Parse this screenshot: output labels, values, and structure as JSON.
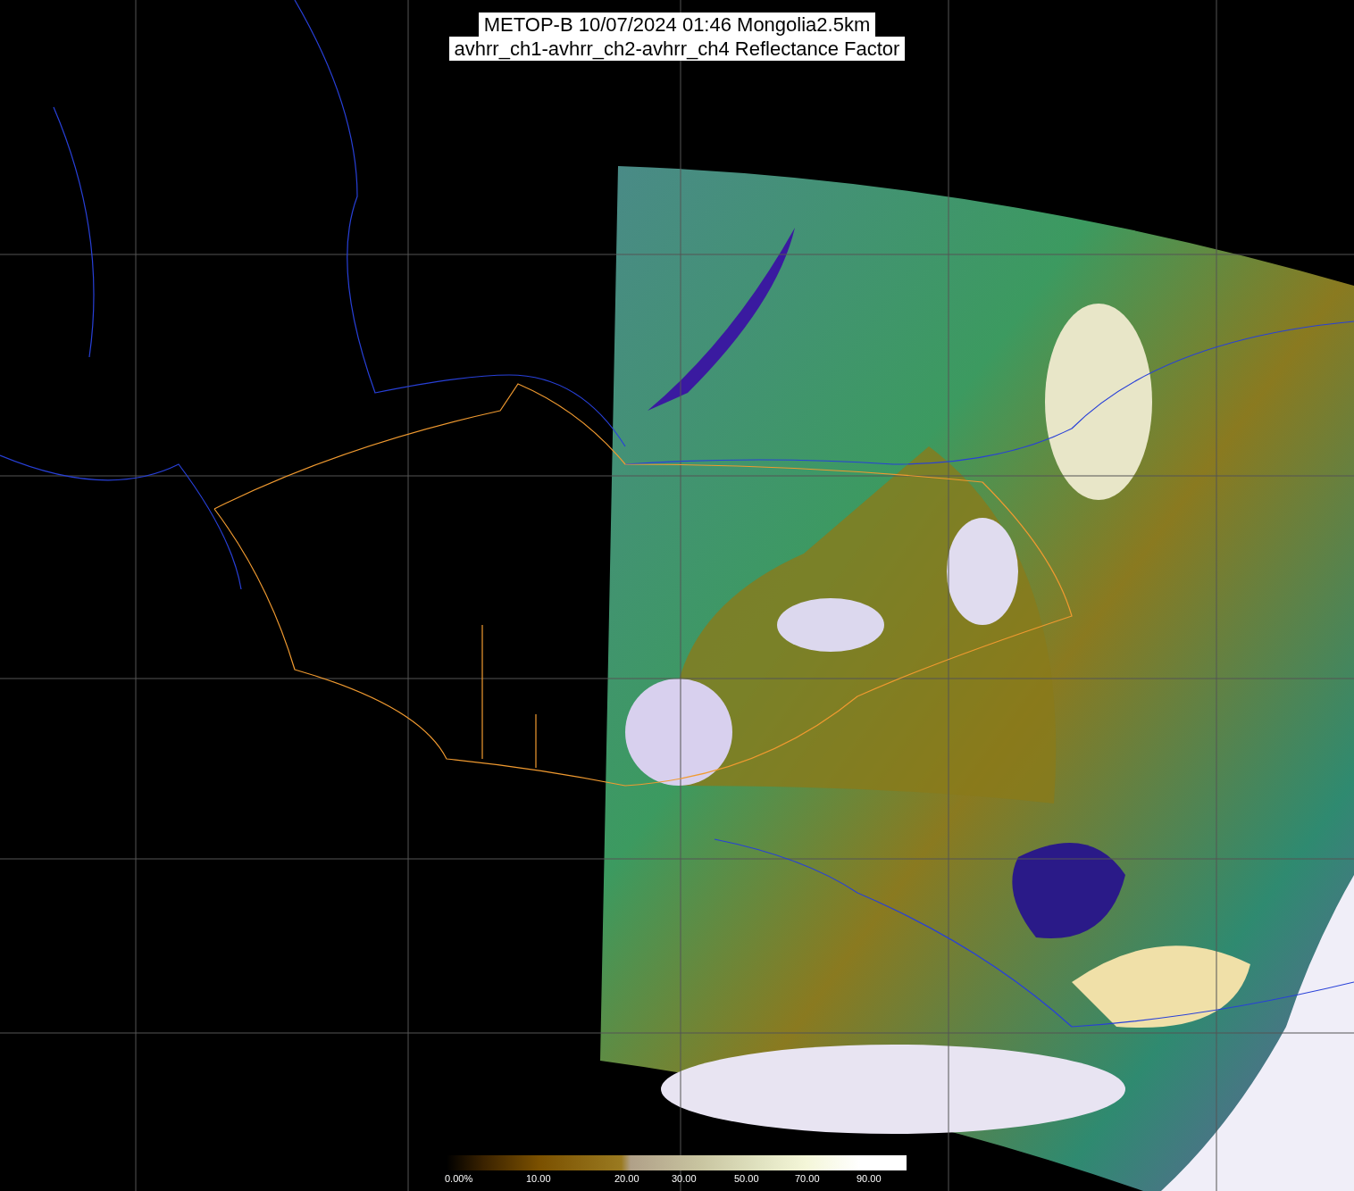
{
  "title": {
    "lines": [
      "METOP-B 10/07/2024 01:46 Mongolia2.5km",
      "avhrr_ch1-avhrr_ch2-avhrr_ch4 Reflectance Factor"
    ]
  },
  "colorbar": {
    "labels": [
      "0.00%",
      "10.00",
      "20.00",
      "30.00",
      "50.00",
      "70.00",
      "90.00"
    ]
  }
}
